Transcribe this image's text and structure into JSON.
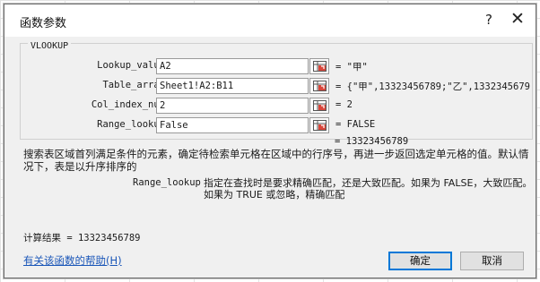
{
  "dialog": {
    "title": "函数参数",
    "help_glyph": "?",
    "close_glyph": "✕"
  },
  "function_name": "VLOOKUP",
  "args": [
    {
      "label": "Lookup_value",
      "input": "A2",
      "value": "= \"甲\""
    },
    {
      "label": "Table_array",
      "input": "Sheet1!A2:B11",
      "value": "= {\"甲\",13323456789;\"乙\",1332345679"
    },
    {
      "label": "Col_index_num",
      "input": "2",
      "value": "= 2"
    },
    {
      "label": "Range_lookup",
      "input": "False",
      "value": "= FALSE"
    }
  ],
  "formula_result": "= 13323456789",
  "description": "搜索表区域首列满足条件的元素，确定待检索单元格在区域中的行序号，再进一步返回选定单元格的值。默认情况下，表是以升序排序的",
  "param_help": {
    "name": "Range_lookup",
    "text": "指定在查找时是要求精确匹配，还是大致匹配。如果为 FALSE，大致匹配。如果为 TRUE 或忽略，精确匹配"
  },
  "calc_result": "计算结果 = 13323456789",
  "help_link": "有关该函数的帮助(H)",
  "buttons": {
    "ok": "确定",
    "cancel": "取消"
  }
}
